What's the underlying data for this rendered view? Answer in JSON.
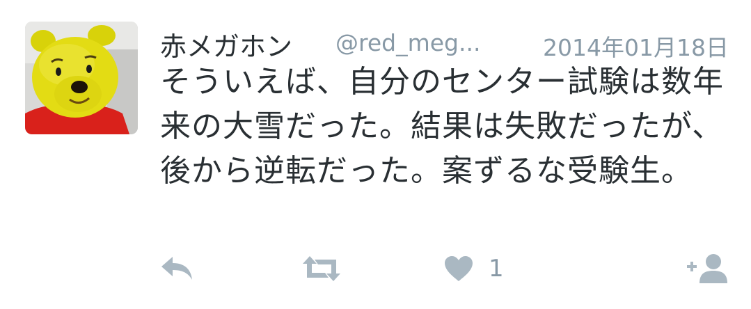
{
  "tweet": {
    "author_name": "赤メガホン",
    "handle": "@red_meg...",
    "date": "2014年01月18日",
    "text": "そういえば、自分のセンター試験は数年来の大雪だった。結果は失敗だったが、後から逆転だった。案ずるな受験生。",
    "like_count": "1"
  },
  "icons": {
    "avatar": "stuffed-bear-photo",
    "reply": "reply-icon",
    "retweet": "retweet-icon",
    "like": "heart-icon",
    "follow": "add-user-icon"
  },
  "colors": {
    "text": "#292f33",
    "muted": "#8899a6",
    "icon": "#aab8c2"
  }
}
